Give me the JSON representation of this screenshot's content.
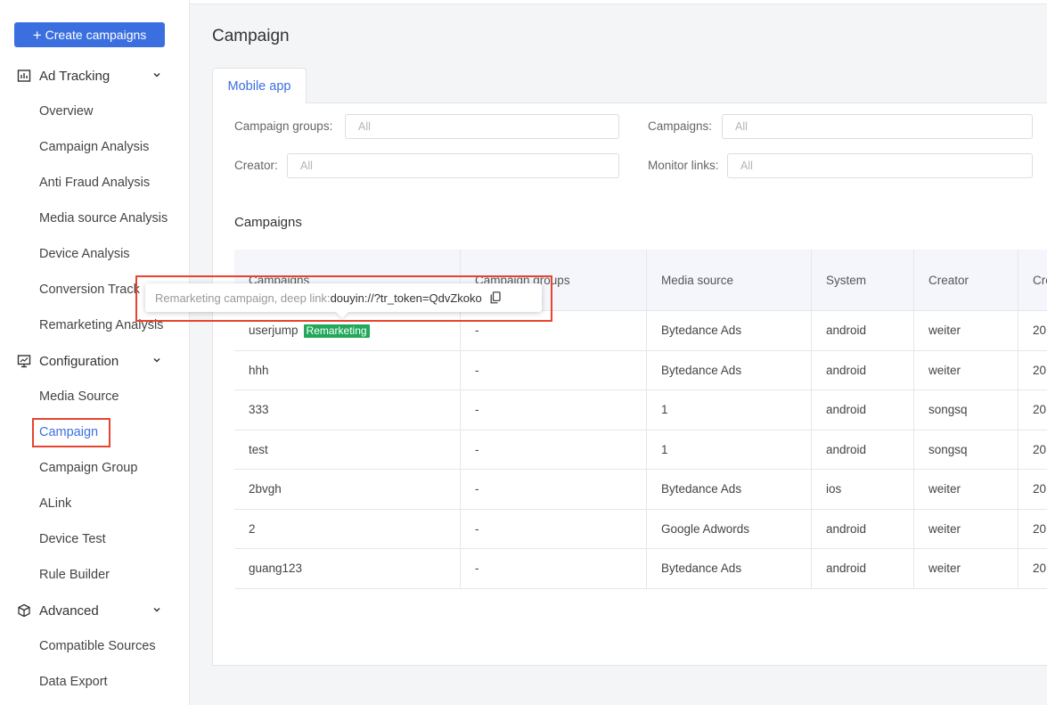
{
  "sidebar": {
    "create_button": "Create campaigns",
    "groups": [
      {
        "label": "Ad Tracking",
        "icon": "bar-chart-icon",
        "items": [
          "Overview",
          "Campaign Analysis",
          "Anti Fraud Analysis",
          "Media source Analysis",
          "Device Analysis",
          "Conversion Track",
          "Remarketing Analysis"
        ]
      },
      {
        "label": "Configuration",
        "icon": "monitor-icon",
        "items": [
          "Media Source",
          "Campaign",
          "Campaign Group",
          "ALink",
          "Device Test",
          "Rule Builder"
        ]
      },
      {
        "label": "Advanced",
        "icon": "cube-icon",
        "items": [
          "Compatible Sources",
          "Data Export"
        ]
      }
    ],
    "active_item": "Campaign"
  },
  "page": {
    "title": "Campaign",
    "tab": "Mobile app"
  },
  "filters": {
    "campaign_groups": {
      "label": "Campaign groups:",
      "placeholder": "All"
    },
    "campaigns": {
      "label": "Campaigns:",
      "placeholder": "All"
    },
    "creator": {
      "label": "Creator:",
      "placeholder": "All"
    },
    "monitor_links": {
      "label": "Monitor links:",
      "placeholder": "All"
    }
  },
  "table": {
    "title": "Campaigns",
    "columns": [
      "Campaigns",
      "Campaign groups",
      "Media source",
      "System",
      "Creator",
      "Cre"
    ],
    "rows": [
      {
        "campaign": "userjump",
        "badge": "Remarketing",
        "group": "-",
        "media": "Bytedance Ads",
        "system": "android",
        "creator": "weiter",
        "created": "20"
      },
      {
        "campaign": "hhh",
        "group": "-",
        "media": "Bytedance Ads",
        "system": "android",
        "creator": "weiter",
        "created": "20"
      },
      {
        "campaign": "333",
        "group": "-",
        "media": "1",
        "system": "android",
        "creator": "songsq",
        "created": "20"
      },
      {
        "campaign": "test",
        "group": "-",
        "media": "1",
        "system": "android",
        "creator": "songsq",
        "created": "20"
      },
      {
        "campaign": "2bvgh",
        "group": "-",
        "media": "Bytedance Ads",
        "system": "ios",
        "creator": "weiter",
        "created": "20"
      },
      {
        "campaign": "2",
        "group": "-",
        "media": "Google Adwords",
        "system": "android",
        "creator": "weiter",
        "created": "20"
      },
      {
        "campaign": "guang123",
        "group": "-",
        "media": "Bytedance Ads",
        "system": "android",
        "creator": "weiter",
        "created": "20"
      }
    ]
  },
  "tooltip": {
    "prefix": "Remarketing campaign, deep link:",
    "link": "douyin://?tr_token=QdvZkoko",
    "icon": "copy-icon"
  },
  "colors": {
    "accent": "#3b6fe0",
    "badge": "#22a85a",
    "highlight": "#e8432e"
  }
}
